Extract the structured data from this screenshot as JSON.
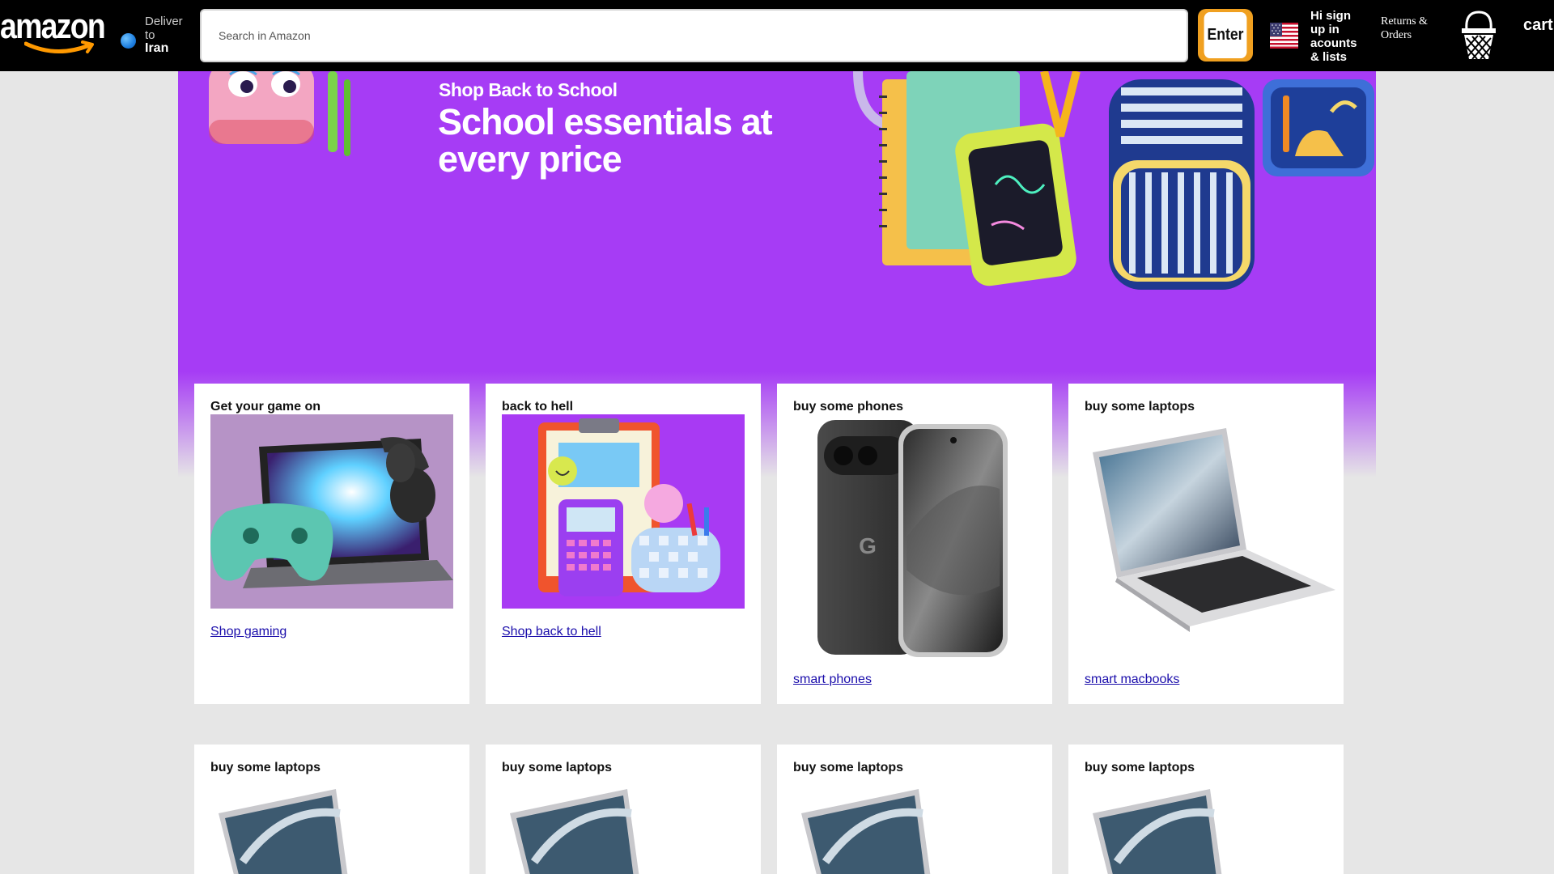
{
  "header": {
    "logo_text": "amazon",
    "deliver_label": "Deliver to",
    "deliver_location": "Iran",
    "search_placeholder": "Search in Amazon",
    "search_button": "Enter",
    "account_text": "Hi sign up in acounts & lists",
    "returns_text": "Returns & Orders",
    "cart_label": "cart"
  },
  "hero": {
    "eyebrow": "Shop Back to School",
    "title": "School essentials at every price",
    "background_color": "#a63cf5"
  },
  "cards": [
    {
      "title": "Get your game on",
      "link": "Shop gaming",
      "icon": "gaming-controller-laptop-image"
    },
    {
      "title": "back to hell",
      "link": "Shop back to hell",
      "icon": "school-supplies-image"
    },
    {
      "title": "buy some phones",
      "link": "smart phones",
      "icon": "smartphones-image"
    },
    {
      "title": "buy some laptops",
      "link": "smart macbooks",
      "icon": "macbook-laptop-image"
    }
  ],
  "cards_row2": [
    {
      "title": "buy some laptops"
    },
    {
      "title": "buy some laptops"
    },
    {
      "title": "buy some laptops"
    },
    {
      "title": "buy some laptops"
    }
  ],
  "colors": {
    "nav_bg": "#000000",
    "accent": "#f0a020",
    "link": "#1a0dab",
    "page_bg": "#e6e6e6"
  }
}
